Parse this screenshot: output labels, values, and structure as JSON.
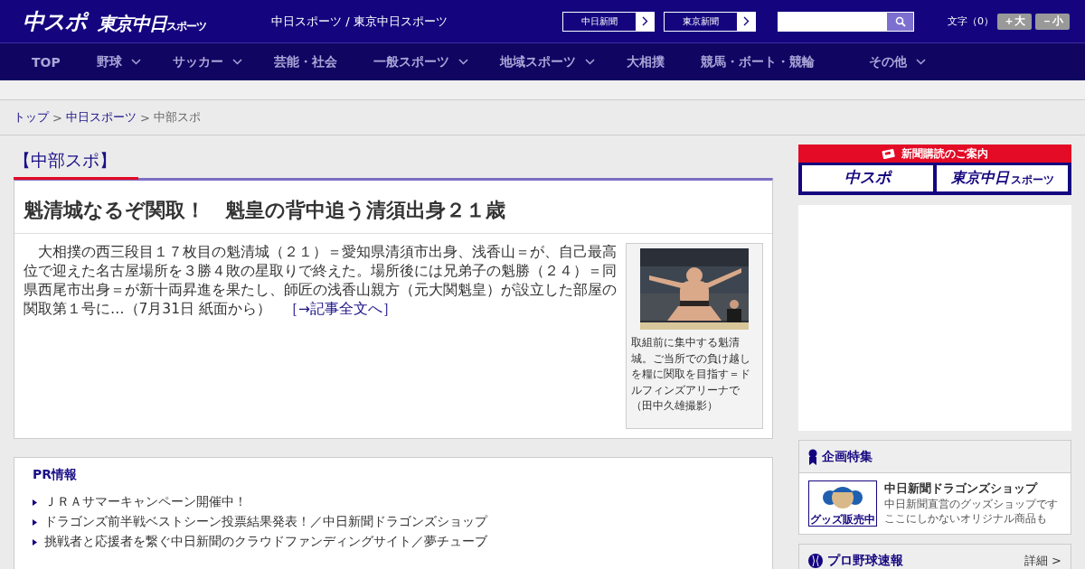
{
  "header": {
    "logo_main": "中スポ",
    "logo_sub": "東京中日",
    "logo_sub_small": "スポーツ",
    "site_title": "中日スポーツ / 東京中日スポーツ",
    "paper_links": [
      {
        "label": "中日新聞"
      },
      {
        "label": "東京新聞"
      }
    ],
    "font_size": {
      "label": "文字（0）",
      "buttons": [
        {
          "label": "＋大"
        },
        {
          "label": "－小"
        }
      ]
    }
  },
  "nav": [
    {
      "label": "TOP",
      "dropdown": false
    },
    {
      "label": "野球",
      "dropdown": true
    },
    {
      "label": "サッカー",
      "dropdown": true
    },
    {
      "label": "芸能・社会",
      "dropdown": false
    },
    {
      "label": "一般スポーツ",
      "dropdown": true
    },
    {
      "label": "地域スポーツ",
      "dropdown": true
    },
    {
      "label": "大相撲",
      "dropdown": false
    },
    {
      "label": "競馬・ボート・競輪",
      "dropdown": false
    },
    {
      "label": "その他",
      "dropdown": true
    }
  ],
  "breadcrumb_separator": ">",
  "breadcrumb": [
    {
      "label": "トップ",
      "link": true
    },
    {
      "label": "中日スポーツ",
      "link": true
    },
    {
      "label": "中部スポ",
      "link": false
    }
  ],
  "section_title": "【中部スポ】",
  "article": {
    "title": "魁清城なるぞ関取！　魁皇の背中追う清須出身２１歳",
    "body": "　大相撲の西三段目１７枚目の魁清城（２１）＝愛知県清須市出身、浅香山＝が、自己最高位で迎えた名古屋場所を３勝４敗の星取りで終えた。場所後には兄弟子の魁勝（２４）＝同県西尾市出身＝が新十両昇進を果たし、師匠の浅香山親方（元大関魁皇）が設立した部屋の関取第１号に…（7月31日 紙面から）",
    "more_link": "［→記事全文へ］",
    "photo": {
      "kind": "picture",
      "caption": "取組前に集中する魁清城。ご当所での負け越しを糧に関取を目指す＝ドルフィンズアリーナで（田中久雄撮影）"
    }
  },
  "pr": {
    "title": "PR情報",
    "items": [
      "ＪＲＡサマーキャンペーン開催中！",
      "ドラゴンズ前半戦ベストシーン投票結果発表！／中日新聞ドラゴンズショップ",
      "挑戦者と応援者を繋ぐ中日新聞のクラウドファンディングサイト／夢チューブ"
    ]
  },
  "sidebar": {
    "subscribe": {
      "title": "新聞購読のご案内",
      "logo_main": "中スポ",
      "logo_sub": "東京中日",
      "logo_sub_small": "スポーツ"
    },
    "feature": {
      "title": "企画特集",
      "banner_text": "グッズ販売中",
      "item_title": "中日新聞ドラゴンズショップ",
      "item_lines": [
        "中日新聞直営のグッズショップです",
        "ここにしかないオリジナル商品も"
      ]
    },
    "baseball": {
      "title": "プロ野球速報",
      "more": "詳細 >"
    }
  }
}
